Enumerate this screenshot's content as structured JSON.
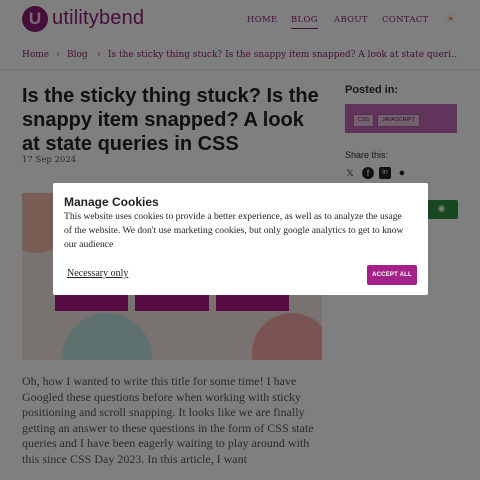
{
  "header": {
    "logo_letter": "U",
    "brand": "utilitybend",
    "nav": [
      {
        "label": "HOME",
        "active": false
      },
      {
        "label": "BLOG",
        "active": true
      },
      {
        "label": "ABOUT",
        "active": false
      },
      {
        "label": "CONTACT",
        "active": false
      }
    ],
    "theme_icon": "sun-icon",
    "theme_glyph": "☀"
  },
  "breadcrumb": {
    "items": [
      "Home",
      "Blog",
      "Is the sticky thing stuck? Is the snappy item snapped? A look at state queri..."
    ],
    "separator": "›"
  },
  "article": {
    "title": "Is the sticky thing stuck? Is the snappy item snapped? A look at state queries in CSS",
    "date": "17 Sep 2024",
    "body": "Oh, how I wanted to write this title for some time! I have Googled these questions before when working with sticky positioning and scroll snapping. It looks like we are finally getting an answer to these questions in the form of CSS state queries and I have been eagerly waiting to play around with this since CSS Day 2023. In this article, I want"
  },
  "sidebar": {
    "posted_in": "Posted in:",
    "tags": [
      "CSS",
      "JAVASCRIPT"
    ],
    "share_label": "Share this:",
    "share_icons": [
      {
        "name": "x-icon",
        "glyph": "𝕏"
      },
      {
        "name": "facebook-icon",
        "glyph": "f"
      },
      {
        "name": "linkedin-icon",
        "glyph": "in"
      },
      {
        "name": "reddit-icon",
        "glyph": "●"
      }
    ],
    "green_button_icon": "rss-icon"
  },
  "cookie_modal": {
    "title": "Manage Cookies",
    "text": "This website uses cookies to provide a better experience, as well as to analyze the usage of the website. We don't use marketing cookies, but only google analytics to get to know our audience",
    "necessary_label": "Necessary only",
    "accept_label": "ACCEPT ALL"
  },
  "colors": {
    "brand": "#8a1f73",
    "accept": "#a5218a",
    "tag_bg": "#c36bb6",
    "green": "#2f8f45"
  }
}
